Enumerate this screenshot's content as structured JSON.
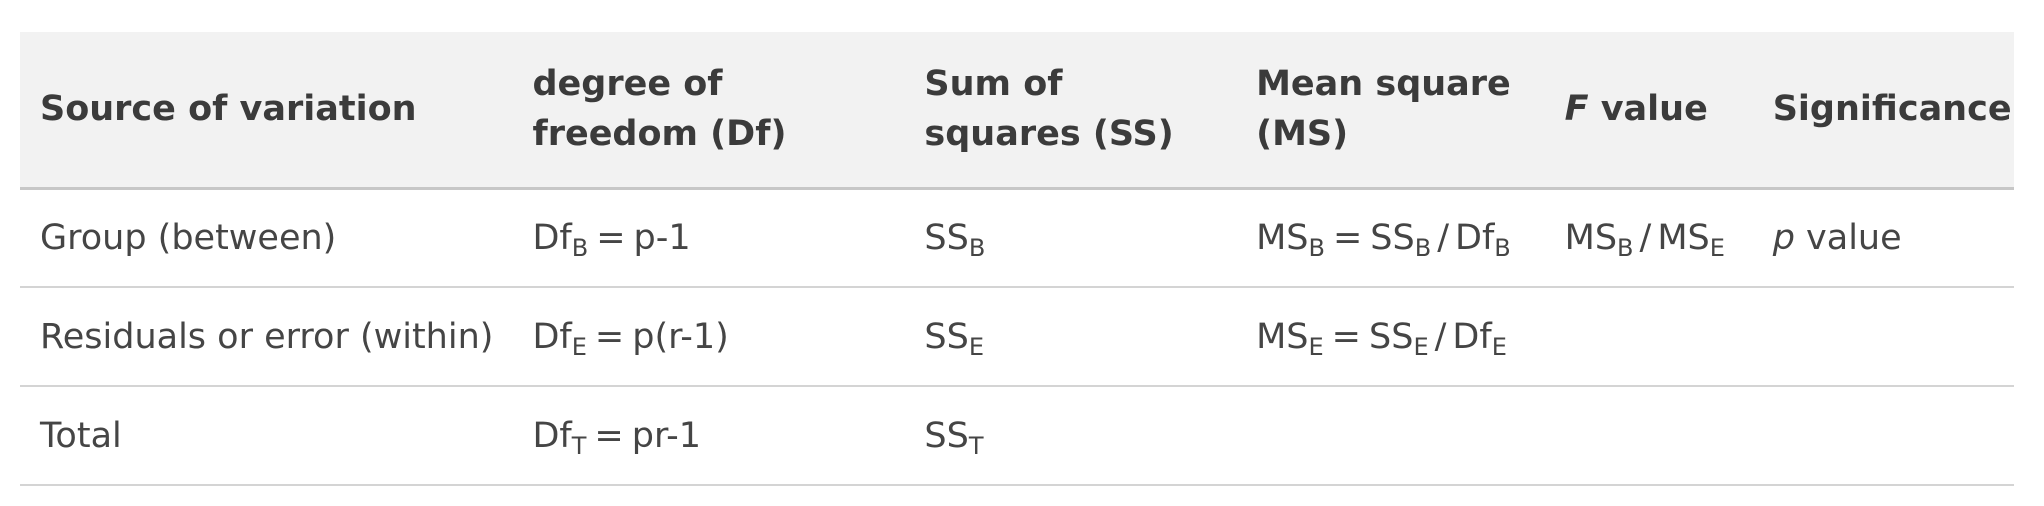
{
  "header": {
    "source": "Source of variation",
    "df": "degree of freedom (Df)",
    "ss": "Sum of squares (SS)",
    "ms": "Mean square (MS)",
    "f_italic": "F",
    "f_rest": " value",
    "significance": "Significance"
  },
  "rows": [
    {
      "source": "Group (between)",
      "df_base": "Df",
      "df_sub": "B",
      "df_expr": "p-1",
      "ss_base": "SS",
      "ss_sub": "B",
      "ms_base": "MS",
      "ms_sub": "B",
      "ms_num_base": "SS",
      "ms_num_sub": "B",
      "ms_den_base": "Df",
      "ms_den_sub": "B",
      "f_num_base": "MS",
      "f_num_sub": "B",
      "f_den_base": "MS",
      "f_den_sub": "E",
      "sig_italic": "p",
      "sig_rest": " value"
    },
    {
      "source": "Residuals or error (within)",
      "df_base": "Df",
      "df_sub": "E",
      "df_expr": "p(r-1)",
      "ss_base": "SS",
      "ss_sub": "E",
      "ms_base": "MS",
      "ms_sub": "E",
      "ms_num_base": "SS",
      "ms_num_sub": "E",
      "ms_den_base": "Df",
      "ms_den_sub": "E"
    },
    {
      "source": "Total",
      "df_base": "Df",
      "df_sub": "T",
      "df_expr": "pr-1",
      "ss_base": "SS",
      "ss_sub": "T"
    }
  ],
  "symbols": {
    "equals": "=",
    "slash": "/"
  }
}
